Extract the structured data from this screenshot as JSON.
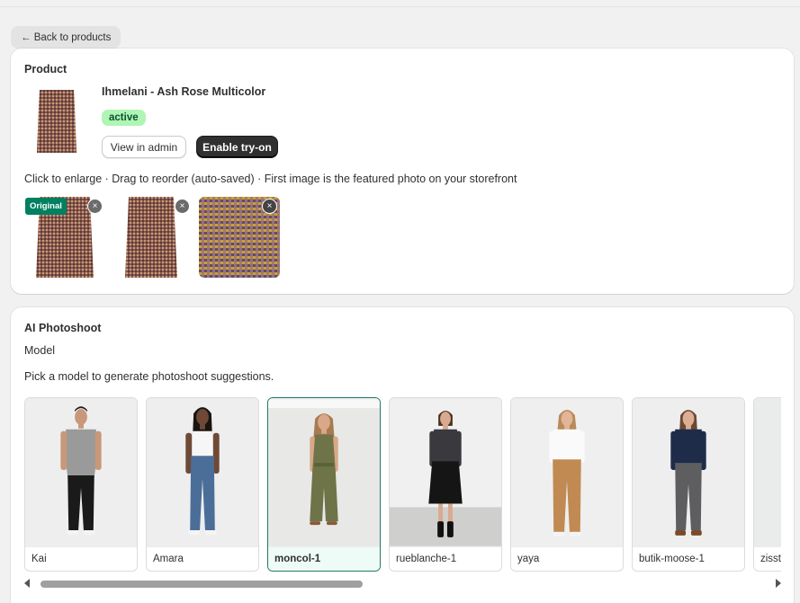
{
  "back_button": {
    "label": "← Back to products"
  },
  "product": {
    "section_title": "Product",
    "name": "Ihmelani - Ash Rose Multicolor",
    "status": "active",
    "view_admin_label": "View in admin",
    "enable_tryon_label": "Enable try-on",
    "gallery_hint": "Click to enlarge · Drag to reorder (auto-saved) · First image is the featured photo on your storefront",
    "original_badge": "Original",
    "remove_symbol": "×",
    "colors": {
      "status_bg": "#aff5b4",
      "badge_green": "#008060",
      "primary_dark": "#303030"
    }
  },
  "ai": {
    "section_title": "AI Photoshoot",
    "model_label": "Model",
    "instruction": "Pick a model to generate photoshoot suggestions.",
    "models": [
      {
        "name": "Kai"
      },
      {
        "name": "Amara"
      },
      {
        "name": "moncol-1"
      },
      {
        "name": "rueblanche-1"
      },
      {
        "name": "yaya"
      },
      {
        "name": "butik-moose-1"
      },
      {
        "name": "zisst"
      }
    ],
    "selected_model": "moncol-1"
  }
}
